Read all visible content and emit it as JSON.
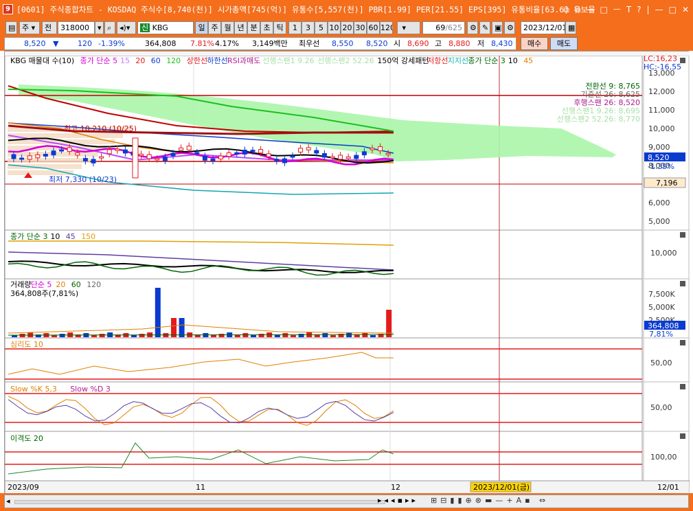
{
  "window": {
    "title": "[0601] 주식종합차트 - KOSDAQ 주식수[8,740(천)] 시가총액[745(억)] 유통수[5,557(천)] PBR[1.99] PER[21.55] EPS[395] 유통비율[63.6] 유보율",
    "app_icon": "9",
    "controls": [
      "⧉",
      "⧉",
      "—",
      "□",
      "ᅳ",
      "T",
      "?",
      "|",
      "—",
      "□",
      "✕"
    ]
  },
  "toolbar": {
    "type_label": "주",
    "type2_label": "전",
    "code": "318000",
    "name": "KBG",
    "name_prefix": "신",
    "periods": [
      "일",
      "주",
      "월",
      "년",
      "분",
      "초",
      "틱"
    ],
    "intervals": [
      "1",
      "3",
      "5",
      "10",
      "20",
      "30",
      "60",
      "120"
    ],
    "count": "69",
    "count_total": "/625",
    "date": "2023/12/01"
  },
  "quote": {
    "price": "8,520",
    "change_arrow": "▼",
    "change": "120",
    "change_pct": "-1.39%",
    "volume": "364,808",
    "vol_pct": "7.81%",
    "turnover": "4.17%",
    "amount": "3,149백만",
    "best_label": "최우선",
    "best_ask": "8,550",
    "best_bid": "8,520",
    "open_label": "시",
    "open": "8,690",
    "high_label": "고",
    "high": "8,880",
    "low_label": "저",
    "low": "8,430",
    "buy_label": "매수",
    "sell_label": "매도"
  },
  "legend_main": [
    {
      "t": "KBG 매물대 수(10)",
      "c": "#000"
    },
    {
      "t": "종가 단순 5",
      "c": "#d400d4"
    },
    {
      "t": "15",
      "c": "#c77dff"
    },
    {
      "t": "20",
      "c": "#e31b1b"
    },
    {
      "t": "60",
      "c": "#0a3bd0"
    },
    {
      "t": "120",
      "c": "#1bbf1b"
    },
    {
      "t": "상한선",
      "c": "#e31b1b"
    },
    {
      "t": "하한선",
      "c": "#0a3bd0"
    },
    {
      "t": "RSI과매도",
      "c": "#b01c8e"
    },
    {
      "t": "선행스팬1 9.26",
      "c": "#a8e0a8"
    },
    {
      "t": "선행스팬2 52.26",
      "c": "#a8e0a8"
    },
    {
      "t": "150억 강세패턴",
      "c": "#000"
    },
    {
      "t": "저항선",
      "c": "#e31b1b"
    },
    {
      "t": "지지선",
      "c": "#14b4b4"
    },
    {
      "t": "종가 단순 3",
      "c": "#006400"
    },
    {
      "t": "10",
      "c": "#000"
    },
    {
      "t": "45",
      "c": "#e07f00"
    }
  ],
  "main_labels": {
    "lc": "LC:16,23",
    "hc": "HC:-16,55",
    "high_note": "최고 10,210 (10/25)",
    "low_note": "최저 7,330 (10/23)",
    "price_box": "8,520",
    "price_pct": "-1.39%",
    "support_box": "7,196"
  },
  "right_notes": [
    {
      "t": "전환선 9: 8,765",
      "c": "#006400"
    },
    {
      "t": "기준선 26: 8,625",
      "c": "#666"
    },
    {
      "t": "후행스팬 26: 8,520",
      "c": "#b01c8e"
    },
    {
      "t": "선행스팬1 9.26: 8,695",
      "c": "#a8e0a8"
    },
    {
      "t": "선행스팬2 52.26: 8,770",
      "c": "#a8e0a8"
    }
  ],
  "yaxis_main": [
    "13,000",
    "12,000",
    "11,000",
    "10,000",
    "9,000",
    "8,000",
    "7,000",
    "6,000",
    "5,000"
  ],
  "panel_ma": {
    "legend": [
      {
        "t": "종가 단순 3",
        "c": "#006400"
      },
      {
        "t": "10",
        "c": "#000"
      },
      {
        "t": "45",
        "c": "#5b3fa0"
      },
      {
        "t": "150",
        "c": "#e0a000"
      }
    ],
    "axis": [
      "10,000"
    ]
  },
  "panel_vol": {
    "legend": [
      {
        "t": "거래량",
        "c": "#000"
      },
      {
        "t": "단순 5",
        "c": "#d400d4"
      },
      {
        "t": "20",
        "c": "#e07f00"
      },
      {
        "t": "60",
        "c": "#006400"
      },
      {
        "t": "120",
        "c": "#666"
      }
    ],
    "sub": "364,808주(7,81%)",
    "axis": [
      "7,500K",
      "5,000K",
      "2,500K"
    ],
    "box": "364,808",
    "box_pct": "7,81%"
  },
  "panel_psy": {
    "legend": [
      {
        "t": "심리도 10",
        "c": "#e07f00"
      }
    ],
    "axis": [
      "50,00"
    ]
  },
  "panel_slow": {
    "legend": [
      {
        "t": "Slow %K 5,3",
        "c": "#e07f00"
      },
      {
        "t": "Slow %D 3",
        "c": "#b01c8e"
      }
    ],
    "axis": [
      "50,00"
    ]
  },
  "panel_disp": {
    "legend": [
      {
        "t": "이격도 20",
        "c": "#006400"
      }
    ],
    "axis": [
      "100,00"
    ]
  },
  "xaxis": {
    "labels": [
      "2023/09",
      "11",
      "12"
    ],
    "cursor": "2023/12/01(금)",
    "right": "12/01"
  },
  "colors": {
    "accent": "#f46e1c",
    "up": "#e31b1b",
    "down": "#0a3bd0"
  }
}
